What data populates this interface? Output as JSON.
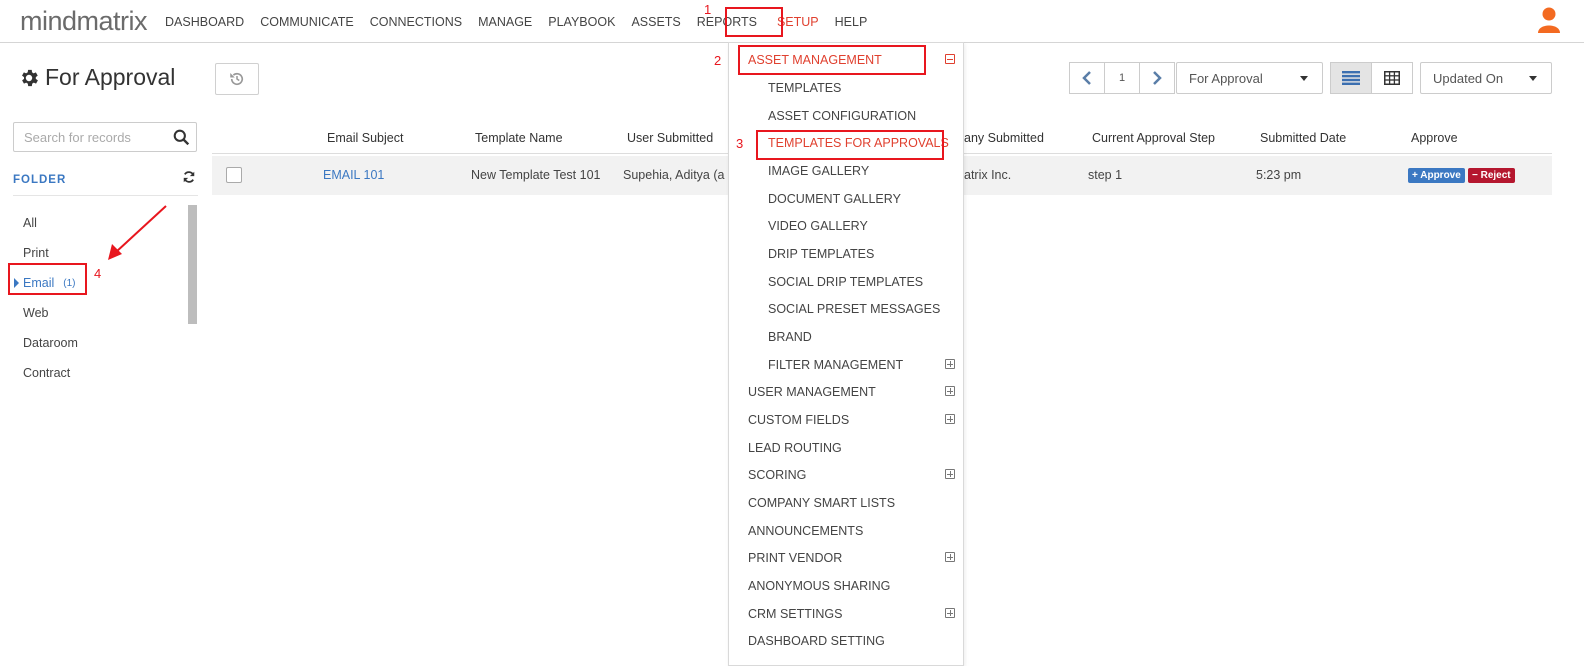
{
  "app": {
    "logo": "mindmatrix"
  },
  "nav": {
    "items": [
      "DASHBOARD",
      "COMMUNICATE",
      "CONNECTIONS",
      "MANAGE",
      "PLAYBOOK",
      "ASSETS",
      "REPORTS",
      "SETUP",
      "HELP"
    ],
    "active": "SETUP"
  },
  "header": {
    "title": "For Approval",
    "icons": {
      "title": "gear-icon",
      "reset": "history-icon",
      "user": "user-icon"
    }
  },
  "pager": {
    "page": "1"
  },
  "filters": {
    "status": "For Approval",
    "sort": "Updated On"
  },
  "sidebar": {
    "search_placeholder": "Search for records",
    "folder_label": "FOLDER",
    "folders": [
      {
        "label": "All",
        "count": ""
      },
      {
        "label": "Print",
        "count": ""
      },
      {
        "label": "Email",
        "count": "(1)"
      },
      {
        "label": "Web",
        "count": ""
      },
      {
        "label": "Dataroom",
        "count": ""
      },
      {
        "label": "Contract",
        "count": ""
      }
    ]
  },
  "table": {
    "headers": [
      "Email Subject",
      "Template Name",
      "User Submitted",
      "any Submitted",
      "Current Approval Step",
      "Submitted Date",
      "Approve"
    ],
    "rows": [
      {
        "subject": "EMAIL 101",
        "template": "New Template Test 101",
        "user": "Supehia, Aditya (a",
        "company": "atrix Inc.",
        "step": "step 1",
        "date": "5:23 pm",
        "approve_label": "+ Approve",
        "reject_label": "− Reject"
      }
    ]
  },
  "menu": {
    "asset_management": "ASSET MANAGEMENT",
    "sub_items": [
      "TEMPLATES",
      "ASSET CONFIGURATION",
      "TEMPLATES FOR APPROVALS",
      "IMAGE GALLERY",
      "DOCUMENT GALLERY",
      "VIDEO GALLERY",
      "DRIP TEMPLATES",
      "SOCIAL DRIP TEMPLATES",
      "SOCIAL PRESET MESSAGES",
      "BRAND",
      "FILTER MANAGEMENT"
    ],
    "items": [
      "USER MANAGEMENT",
      "CUSTOM FIELDS",
      "LEAD ROUTING",
      "SCORING",
      "COMPANY SMART LISTS",
      "ANNOUNCEMENTS",
      "PRINT VENDOR",
      "ANONYMOUS SHARING",
      "CRM SETTINGS",
      "DASHBOARD SETTING"
    ]
  },
  "annotations": [
    "1",
    "2",
    "3",
    "4"
  ],
  "colors": {
    "accent_red": "#e0402f",
    "link_blue": "#3b78c2",
    "approve": "#3b78c2",
    "reject": "#b5172f",
    "annotation": "#e8161e"
  }
}
